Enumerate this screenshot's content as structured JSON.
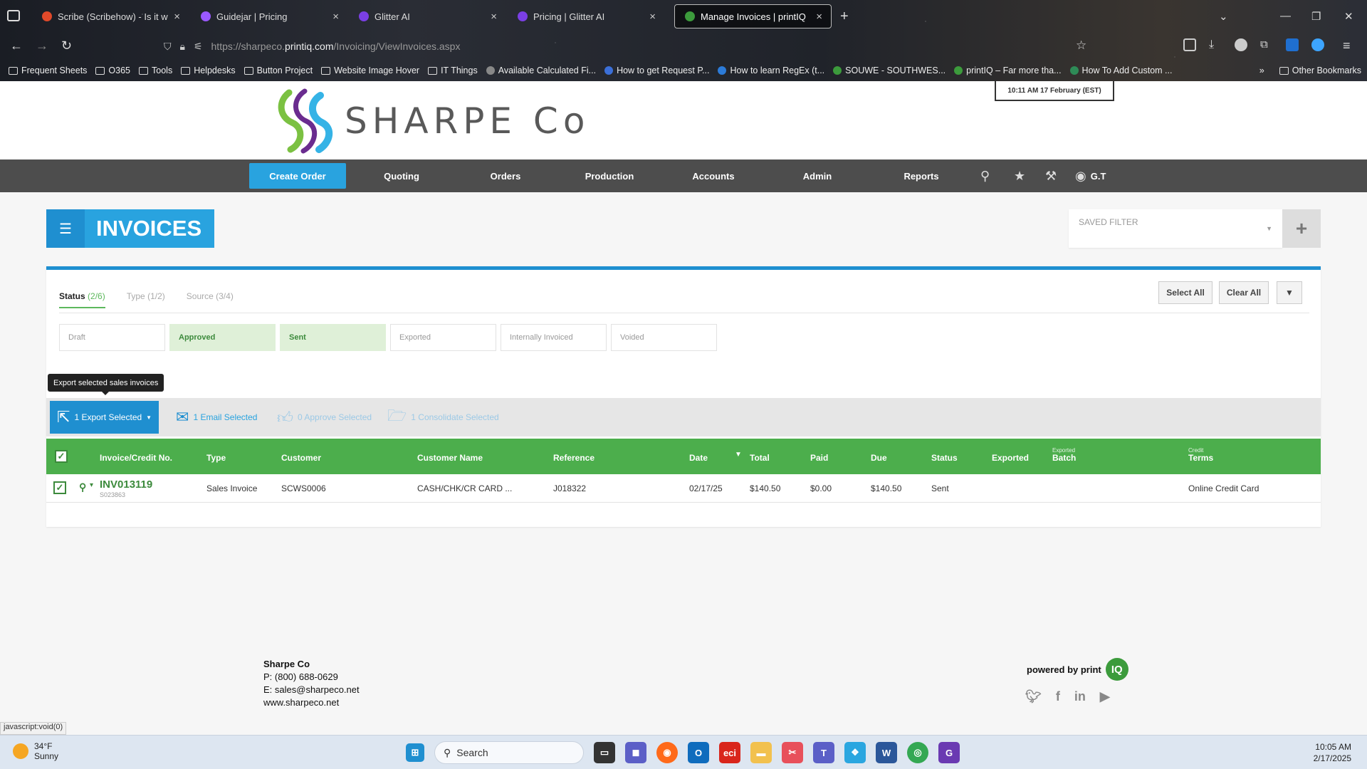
{
  "browser": {
    "tabs": [
      {
        "title": "Scribe (Scribehow) - Is it worth",
        "color": "#e0492a"
      },
      {
        "title": "Guidejar | Pricing",
        "color": "#9b59ff"
      },
      {
        "title": "Glitter AI",
        "color": "#7b3fe4"
      },
      {
        "title": "Pricing | Glitter AI",
        "color": "#7b3fe4"
      },
      {
        "title": "Manage Invoices | printIQ",
        "color": "#3c9b3c"
      }
    ],
    "url_prefix": "https://sharpeco.",
    "url_domain": "printiq.com",
    "url_path": "/Invoicing/ViewInvoices.aspx",
    "bookmarks": [
      {
        "label": "Frequent Sheets",
        "kind": "folder"
      },
      {
        "label": "O365",
        "kind": "folder"
      },
      {
        "label": "Tools",
        "kind": "folder"
      },
      {
        "label": "Helpdesks",
        "kind": "folder"
      },
      {
        "label": "Button Project",
        "kind": "folder"
      },
      {
        "label": "Website Image Hover",
        "kind": "folder"
      },
      {
        "label": "IT Things",
        "kind": "folder"
      },
      {
        "label": "Available Calculated Fi...",
        "kind": "site",
        "color": "#888"
      },
      {
        "label": "How to get Request P...",
        "kind": "site",
        "color": "#3b6fd8"
      },
      {
        "label": "How to learn RegEx (t...",
        "kind": "site",
        "color": "#2c7bd8"
      },
      {
        "label": "SOUWE - SOUTHWES...",
        "kind": "site",
        "color": "#3c9b3c"
      },
      {
        "label": "printIQ – Far more tha...",
        "kind": "site",
        "color": "#3c9b3c"
      },
      {
        "label": "How To Add Custom ...",
        "kind": "site",
        "color": "#2e8b57"
      }
    ],
    "other_bookmarks": "Other Bookmarks"
  },
  "header": {
    "logo_text": "SHARPE Co",
    "clock": "10:11 AM  17 February (EST)"
  },
  "nav": {
    "create_order": "Create Order",
    "items": [
      "Quoting",
      "Orders",
      "Production",
      "Accounts",
      "Admin",
      "Reports"
    ],
    "user": "G.T"
  },
  "page": {
    "title": "INVOICES",
    "saved_filter": "SAVED FILTER"
  },
  "filters": {
    "tabs": [
      {
        "label": "Status",
        "count": "(2/6)"
      },
      {
        "label": "Type",
        "count": "(1/2)"
      },
      {
        "label": "Source",
        "count": "(3/4)"
      }
    ],
    "select_all": "Select All",
    "clear_all": "Clear All",
    "status_chips": [
      {
        "label": "Draft",
        "on": false
      },
      {
        "label": "Approved",
        "on": true
      },
      {
        "label": "Sent",
        "on": true
      },
      {
        "label": "Exported",
        "on": false
      },
      {
        "label": "Internally Invoiced",
        "on": false
      },
      {
        "label": "Voided",
        "on": false
      }
    ]
  },
  "tooltip": "Export selected sales invoices",
  "actions": {
    "export": "1 Export Selected",
    "email": "1 Email Selected",
    "approve": "0 Approve Selected",
    "consolidate": "1 Consolidate Selected"
  },
  "table": {
    "columns": {
      "invoice": "Invoice/Credit No.",
      "type": "Type",
      "customer": "Customer",
      "customer_name": "Customer Name",
      "reference": "Reference",
      "date": "Date",
      "total": "Total",
      "paid": "Paid",
      "due": "Due",
      "status": "Status",
      "exported": "Exported",
      "batch_sup": "Exported",
      "batch": "Batch",
      "terms_sup": "Credit",
      "terms": "Terms"
    },
    "rows": [
      {
        "invoice": "INV013119",
        "sub": "S023863",
        "type": "Sales Invoice",
        "customer": "SCWS0006",
        "customer_name": "CASH/CHK/CR CARD ...",
        "reference": "J018322",
        "date": "02/17/25",
        "total": "$140.50",
        "paid": "$0.00",
        "due": "$140.50",
        "status": "Sent",
        "terms": "Online Credit Card"
      }
    ]
  },
  "footer": {
    "company": "Sharpe Co",
    "phone": "P: (800) 688-0629",
    "email": "E: sales@sharpeco.net",
    "web": "www.sharpeco.net",
    "powered": "powered by print",
    "iq": "IQ"
  },
  "status_url": "javascript:void(0)",
  "taskbar": {
    "temp": "34°F",
    "weather": "Sunny",
    "search": "Search",
    "time": "10:05 AM",
    "date": "2/17/2025"
  }
}
